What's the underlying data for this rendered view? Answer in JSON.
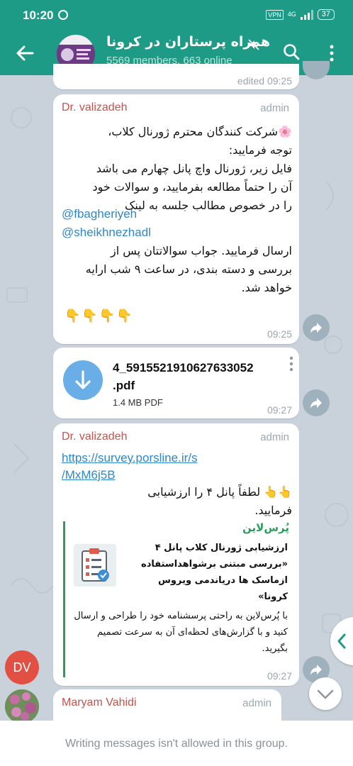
{
  "status_bar": {
    "time": "10:20",
    "vpn": "VPN",
    "network": "4G",
    "battery": "37"
  },
  "header": {
    "title": "همراه پرستاران در کرونا",
    "subtitle": "5569 members, 663 online"
  },
  "messages": [
    {
      "edited_label": "edited 09:25"
    },
    {
      "sender": "Dr. valizadeh",
      "role": "admin",
      "lines": [
        "🌸شرکت کنندگان محترم ژورنال کلاب،",
        "توجه فرمایید:",
        "فایل زیر، ژورنال واچ پانل چهارم می باشد",
        "آن را حتماً مطالعه بفرمایید، و سوالات خود",
        "را در خصوص مطالب جلسه به لینک"
      ],
      "mentions": [
        "@fbagheriyeh",
        "@sheikhnezhadl"
      ],
      "lines2": [
        "ارسال فرمایید. جواب سوالاتتان پس از",
        "بررسی و دسته بندی، در ساعت ۹ شب ارایه",
        "خواهد شد."
      ],
      "emoji": "👇👇👇👇",
      "time": "09:25"
    },
    {
      "file_name_line1": "4_5915521910627633052",
      "file_name_line2": ".pdf",
      "file_size": "1.4 MB PDF",
      "time": "09:27"
    },
    {
      "sender": "Dr. valizadeh",
      "role": "admin",
      "link_line1": "https://survey.porsline.ir/s",
      "link_line2": "/MxM6j5B",
      "text_line1": "👆👆 لطفاً پانل ۴ را ارزشیابی",
      "text_line2": "فرمایید.",
      "preview": {
        "site": "پُرس‌لاین",
        "title": "ارزشیابی ژورنال کلاب پانل ۴ «بررسی مبتنی برشواهداستفاده ازماسک ها دریاندمی ویروس کرونا»",
        "description": "با پُرس‌لاین به راحتی پرسشنامه خود را طراحی و ارسال کنید و با گزارش‌های لحظه‌ای آن به سرعت تصمیم بگیرید."
      },
      "time": "09:27",
      "avatar_initials": "DV"
    },
    {
      "sender": "Maryam Vahidi",
      "role": "admin"
    }
  ],
  "footer": {
    "notice": "Writing messages isn't allowed in this group."
  }
}
